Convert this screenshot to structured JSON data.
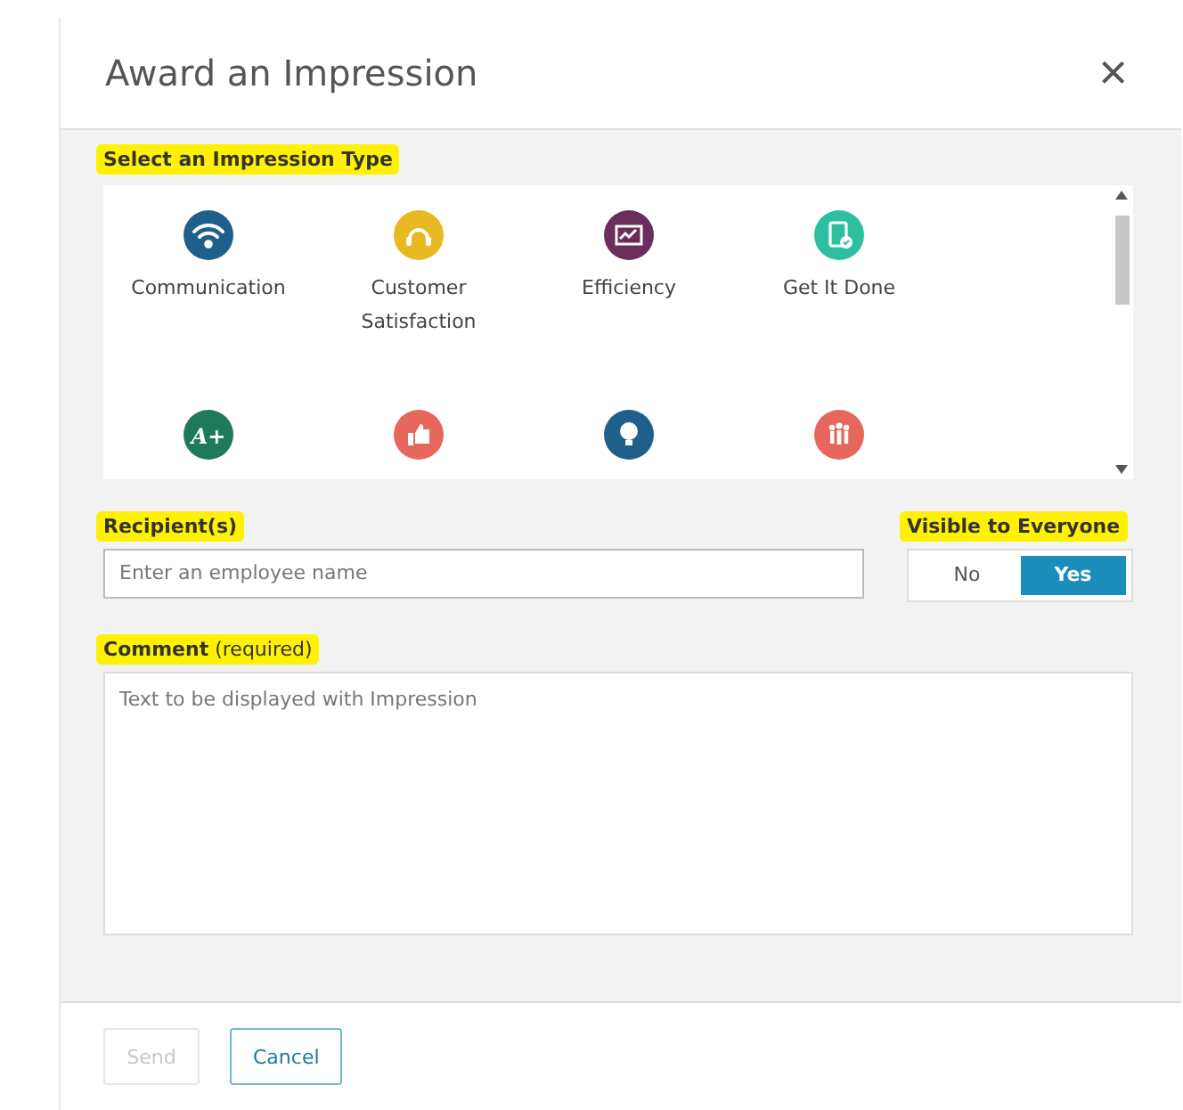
{
  "dialog": {
    "title": "Award an Impression",
    "close": "×"
  },
  "impression_type": {
    "label": "Select an Impression Type",
    "highlighted": true,
    "items": [
      {
        "kind": "wifi",
        "color": "#1f5f8b",
        "label": "Communication"
      },
      {
        "kind": "headset",
        "color": "#e8b923",
        "label": "Customer Satisfaction"
      },
      {
        "kind": "chart",
        "color": "#6b2d5c",
        "label": "Efficiency"
      },
      {
        "kind": "clipboard",
        "color": "#2dbf9f",
        "label": "Get It Done"
      },
      {
        "kind": "glyph",
        "color": "#1f7a5c",
        "glyph": "A+"
      },
      {
        "kind": "thumb",
        "color": "#e8675c"
      },
      {
        "kind": "bulb",
        "color": "#1f5f8b"
      },
      {
        "kind": "people",
        "color": "#e8675c"
      }
    ]
  },
  "recipients": {
    "label": "Recipient(s)",
    "highlighted": true,
    "placeholder": "Enter an employee name"
  },
  "visibility": {
    "label": "Visible to Everyone",
    "highlighted": true,
    "options": [
      {
        "label": "No",
        "selected": false
      },
      {
        "label": "Yes",
        "selected": true
      }
    ]
  },
  "comment": {
    "label": "**Comment** (required)",
    "highlighted": true,
    "placeholder": "Text to be displayed with Impression"
  },
  "buttons": [
    {
      "label": "Send",
      "kind": "primary",
      "disabled": true
    },
    {
      "label": "Cancel",
      "kind": "secondary",
      "disabled": false
    }
  ]
}
